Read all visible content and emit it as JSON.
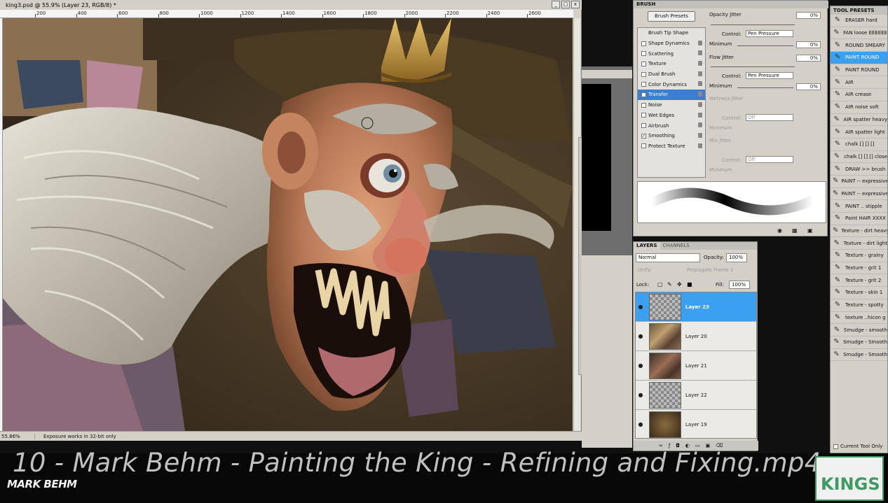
{
  "document": {
    "title": "king3.psd @ 55.9% (Layer 23, RGB/8) *",
    "ruler_labels": [
      "200",
      "400",
      "600",
      "800",
      "1000",
      "1200",
      "1400",
      "1600",
      "1800",
      "2000",
      "2200",
      "2400",
      "2600"
    ],
    "zoom": "55.86%",
    "status_message": "Exposure works in 32-bit only",
    "window_buttons": [
      "_",
      "□",
      "x"
    ]
  },
  "brush_panel": {
    "tab_label": "BRUSH",
    "presets_button": "Brush Presets",
    "items": [
      {
        "label": "Brush Tip Shape",
        "checked": null
      },
      {
        "label": "Shape Dynamics",
        "checked": false
      },
      {
        "label": "Scattering",
        "checked": false
      },
      {
        "label": "Texture",
        "checked": false
      },
      {
        "label": "Dual Brush",
        "checked": false
      },
      {
        "label": "Color Dynamics",
        "checked": false
      },
      {
        "label": "Transfer",
        "checked": true,
        "selected": true
      },
      {
        "label": "Noise",
        "checked": false
      },
      {
        "label": "Wet Edges",
        "checked": false
      },
      {
        "label": "Airbrush",
        "checked": false
      },
      {
        "label": "Smoothing",
        "checked": true
      },
      {
        "label": "Protect Texture",
        "checked": false
      }
    ],
    "opacity_jitter_label": "Opacity Jitter",
    "opacity_jitter_value": "0%",
    "control_label": "Control:",
    "control_value_1": "Pen Pressure",
    "minimum_label": "Minimum",
    "minimum_value_1": "0%",
    "flow_jitter_label": "Flow Jitter",
    "flow_jitter_value": "0%",
    "control_value_2": "Pen Pressure",
    "minimum_value_2": "0%",
    "wetness_jitter_label": "Wetness Jitter",
    "control_value_3": "Off",
    "mix_jitter_label": "Mix Jitter",
    "control_value_4": "Off"
  },
  "layers_panel": {
    "tabs": [
      "LAYERS",
      "CHANNELS"
    ],
    "blend_mode": "Normal",
    "opacity_label": "Opacity:",
    "opacity_value": "100%",
    "unify_label": "Unify:",
    "propagate_label": "Propagate Frame 1",
    "lock_label": "Lock:",
    "fill_label": "Fill:",
    "fill_value": "100%",
    "layers": [
      {
        "name": "Layer 23",
        "selected": true,
        "thumb": "checker"
      },
      {
        "name": "Layer 20",
        "selected": false,
        "thumb": "art-a"
      },
      {
        "name": "Layer 21",
        "selected": false,
        "thumb": "art-b"
      },
      {
        "name": "Layer 22",
        "selected": false,
        "thumb": "checker"
      },
      {
        "name": "Layer 19",
        "selected": false,
        "thumb": "art-c"
      }
    ],
    "footer_icons": [
      "link-icon",
      "fx-icon",
      "mask-icon",
      "adjustment-icon",
      "folder-icon",
      "new-layer-icon",
      "trash-icon"
    ]
  },
  "tool_presets": {
    "tab_label": "TOOL PRESETS",
    "items": [
      "ERASER hard",
      "FAN loose EEEEEE",
      "ROUND SMEARY",
      "PAINT ROUND",
      "PAINT ROUND",
      "AIR",
      "AIR crease",
      "AIR noise soft",
      "AIR spatter heavy",
      "AIR spatter light",
      "chalk [] [] []",
      "chalk [] [] [] close",
      "DRAW >> brush",
      "PAINT -- expressive",
      "PAINT -- expressive",
      "PAINT .. stipple",
      "Paint HAIR XXXX",
      "Texture - dirt heavy",
      "Texture - dirt light",
      "Texture - grainy",
      "Texture - grit 1",
      "Texture - grit 2",
      "Texture - skin 1",
      "Texture - spotty",
      "texture ..hicon g",
      "Smudge - smooth",
      "Smudge - Smooth",
      "Smudge - Smooth"
    ],
    "selected_index": 3,
    "current_tool_only": "Current Tool Only"
  },
  "overlay": {
    "video_title": "10 - Mark Behm - Painting the King - Refining and Fixing.mp4",
    "brand": "MARK BEHM",
    "badge": "KINGS"
  },
  "colors": {
    "selection_blue": "#3ca0f0",
    "panel_gray": "#d4d0c8",
    "badge_green": "#3f9a64"
  }
}
